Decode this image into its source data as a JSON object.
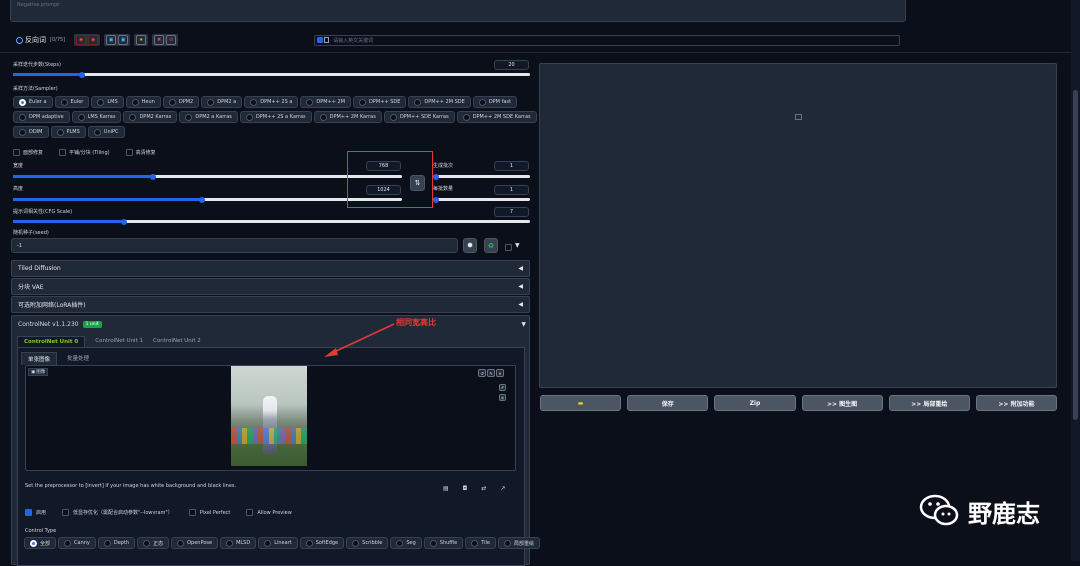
{
  "negative_prompt": {
    "placeholder": "Negative prompt"
  },
  "reverse_prompt": {
    "label": "反向词",
    "count": "[0/75]"
  },
  "tag_search": {
    "placeholder": "请输入英文关键词"
  },
  "steps": {
    "label": "采样迭代步数(Steps)",
    "value": "20",
    "fraction": 0.134
  },
  "sampler": {
    "label": "采样方法(Sampler)",
    "selected": "Euler a",
    "rows": [
      [
        "Euler a",
        "Euler",
        "LMS",
        "Heun",
        "DPM2",
        "DPM2 a",
        "DPM++ 2S a",
        "DPM++ 2M",
        "DPM++ SDE",
        "DPM++ 2M SDE",
        "DPM fast"
      ],
      [
        "DPM adaptive",
        "LMS Karras",
        "DPM2 Karras",
        "DPM2 a Karras",
        "DPM++ 2S a Karras",
        "DPM++ 2M Karras",
        "DPM++ SDE Karras",
        "DPM++ 2M SDE Karras"
      ],
      [
        "DDIM",
        "PLMS",
        "UniPC"
      ]
    ]
  },
  "checkboxes": {
    "face_restore": "面部修复",
    "tiling": "平铺/分块 (Tiling)",
    "hires": "高清修复"
  },
  "width": {
    "label": "宽度",
    "value": "768",
    "fraction": 0.36
  },
  "height": {
    "label": "高度",
    "value": "1024",
    "fraction": 0.485
  },
  "swap_icon": "swap-arrows-icon",
  "batch_count": {
    "label": "生成批次",
    "value": "1"
  },
  "batch_size": {
    "label": "每批数量",
    "value": "1"
  },
  "cfg": {
    "label": "提示词相关性(CFG Scale)",
    "value": "7",
    "fraction": 0.214
  },
  "seed": {
    "label": "随机种子(seed)",
    "value": "-1"
  },
  "accordions": [
    "Tiled Diffusion",
    "分块 VAE",
    "可选附加网络(LoRA插件)"
  ],
  "controlnet": {
    "title": "ControlNet v1.1.230",
    "badge": "1 unit",
    "units": [
      "ControlNet Unit 0",
      "ControlNet Unit 1",
      "ControlNet Unit 2"
    ],
    "subtabs": [
      "单张图像",
      "批量处理"
    ],
    "image_label": "图像",
    "image_caption": "Set the preprocessor to [invert] if your image has white background and black lines.",
    "options": {
      "enable": "启用",
      "lowvram": "低显存优化（需配合启动参数\"--lowvram\"）",
      "pixel_perfect": "Pixel Perfect",
      "allow_preview": "Allow Preview"
    },
    "control_type_label": "Control Type",
    "control_types": [
      "全部",
      "Canny",
      "Depth",
      "正态",
      "OpenPose",
      "MLSD",
      "Lineart",
      "SoftEdge",
      "Scribble",
      "Seg",
      "Shuffle",
      "Tile",
      "局部重绘"
    ],
    "selected_type": "全部"
  },
  "annotation": {
    "text": "相同宽高比",
    "color": "#e53935"
  },
  "output_buttons": [
    {
      "label": "",
      "icon": "folder-icon"
    },
    {
      "label": "保存"
    },
    {
      "label": "Zip"
    },
    {
      "label": ">> 图生图"
    },
    {
      "label": ">> 局部重绘"
    },
    {
      "label": ">> 附加功能"
    }
  ],
  "watermark": {
    "text": "野鹿志"
  },
  "colors": {
    "accent": "#2563eb",
    "bg": "#0b0f19",
    "panel": "#1f2937",
    "badge": "#16a34a"
  }
}
